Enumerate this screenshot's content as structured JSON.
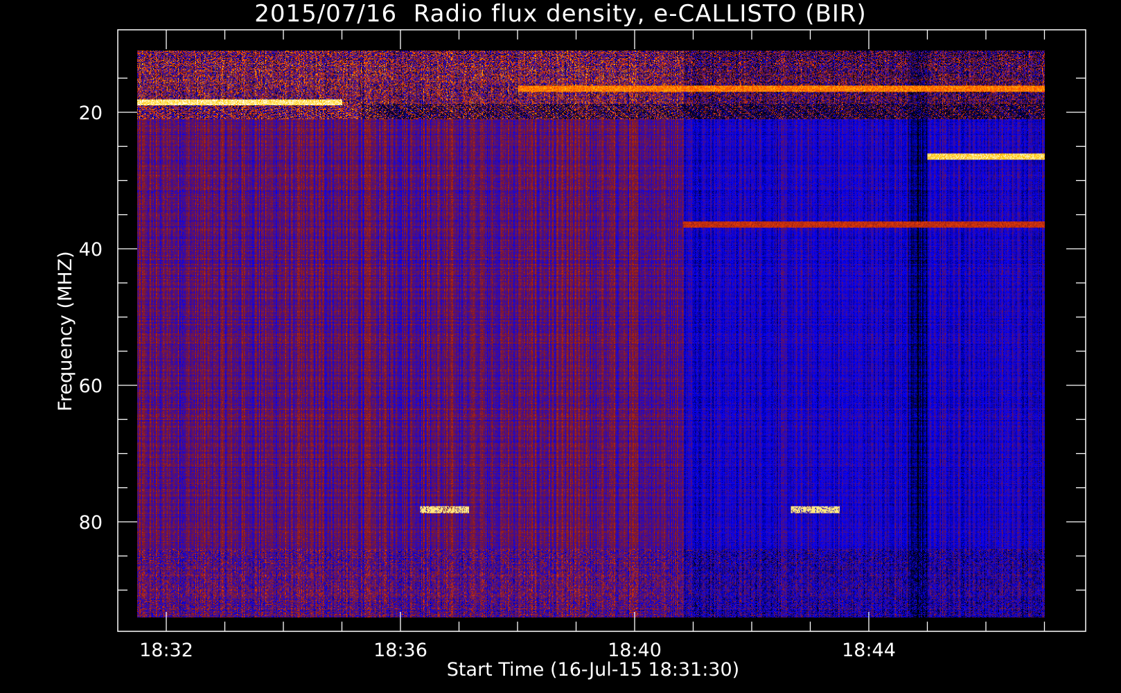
{
  "chart_data": {
    "type": "heatmap",
    "title": "2015/07/16  Radio flux density, e-CALLISTO (BIR)",
    "xlabel": "Start Time (16-Jul-15 18:31:30)",
    "ylabel": "Frequency (MHZ)",
    "x_start": "18:31:30",
    "x_end": "18:47:00",
    "x_ticks": [
      "18:32",
      "18:36",
      "18:40",
      "18:44"
    ],
    "x_minor_step_minutes": 1,
    "ylim": [
      95,
      10
    ],
    "y_ticks": [
      20,
      40,
      60,
      80
    ],
    "y_minor_step": 5,
    "data_freq_range": [
      11,
      94
    ],
    "colormap": [
      "#000000",
      "#0000ff",
      "#8b1a1a",
      "#ff4500",
      "#ffd000",
      "#ffffff"
    ],
    "features": [
      {
        "type": "horizontal_band",
        "freq": 18.5,
        "t_start": "18:31:30",
        "t_end": "18:35:00",
        "intensity": 1.0
      },
      {
        "type": "horizontal_band",
        "freq": 16.5,
        "t_start": "18:38:00",
        "t_end": "18:47:00",
        "intensity": 0.75
      },
      {
        "type": "horizontal_band",
        "freq": 26.5,
        "t_start": "18:45:00",
        "t_end": "18:47:00",
        "intensity": 0.95
      },
      {
        "type": "horizontal_band",
        "freq": 36.5,
        "t_start": "18:40:50",
        "t_end": "18:47:00",
        "intensity": 0.55
      },
      {
        "type": "spot",
        "freq": 78.3,
        "t_start": "18:36:20",
        "t_end": "18:37:10",
        "intensity": 0.9
      },
      {
        "type": "spot",
        "freq": 78.3,
        "t_start": "18:42:40",
        "t_end": "18:43:30",
        "intensity": 0.9
      }
    ]
  }
}
